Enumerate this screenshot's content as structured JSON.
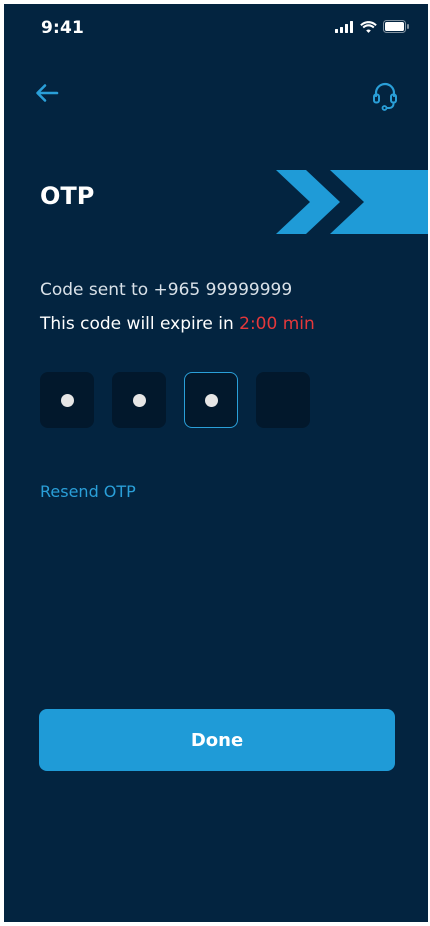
{
  "status_bar": {
    "time": "9:41",
    "icons": [
      "signal-icon",
      "wifi-icon",
      "battery-icon"
    ]
  },
  "header": {
    "back_icon": "arrow-left-icon",
    "support_icon": "headset-icon"
  },
  "page": {
    "title": "OTP",
    "code_sent_text": "Code sent to +965 99999999",
    "expire_prefix": "This code will expire in ",
    "expire_time": "2:00 min"
  },
  "otp": {
    "digits": [
      "•",
      "•",
      "•",
      ""
    ],
    "active_index": 2
  },
  "actions": {
    "resend_label": "Resend OTP",
    "done_label": "Done"
  },
  "colors": {
    "background": "#032440",
    "accent": "#1f9bd7",
    "otp_box": "#02182c",
    "warning": "#e5383b"
  }
}
